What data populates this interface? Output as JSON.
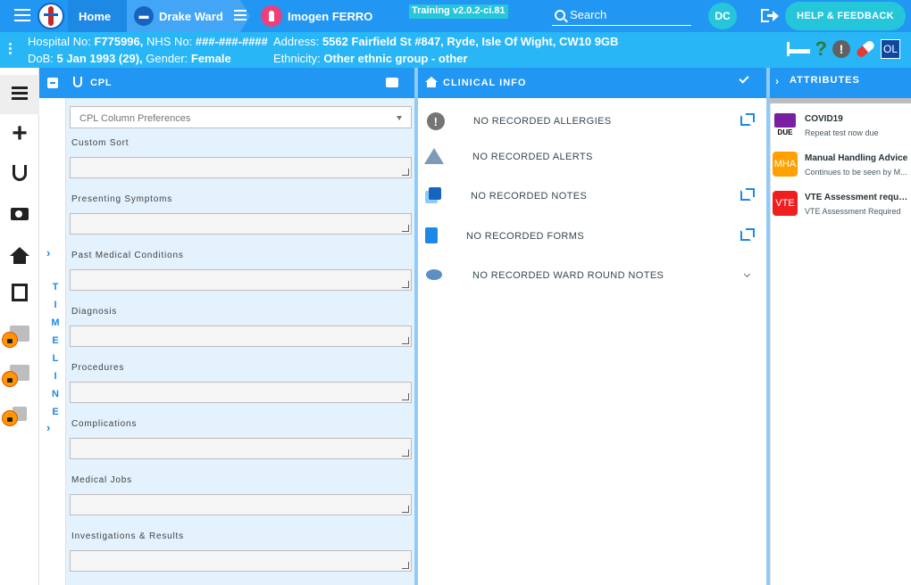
{
  "topbar": {
    "home_label": "Home",
    "ward_label": "Drake Ward",
    "patient_label": "Imogen FERRO",
    "training_badge": "Training v2.0.2-ci.81",
    "search_placeholder": "Search",
    "avatar_initials": "DC",
    "help_label": "HELP & FEEDBACK"
  },
  "patient": {
    "hospital_no_label": "Hospital No:",
    "hospital_no": "F775996,",
    "nhs_no_label": "NHS No:",
    "nhs_no": "###-###-####",
    "address_label": "Address:",
    "address": "5562 Fairfield St #847, Ryde, Isle Of Wight, CW10 9GB",
    "dob_label": "DoB:",
    "dob": "5 Jan 1993 (29),",
    "gender_label": "Gender:",
    "gender": "Female",
    "ethnicity_label": "Ethnicity:",
    "ethnicity": "Other ethnic group - other",
    "ol_badge": "OL"
  },
  "timeline": {
    "label": "TIMELINE"
  },
  "cpl": {
    "title": "CPL",
    "prefs_placeholder": "CPL Column Preferences",
    "fields": [
      {
        "label": "Custom Sort"
      },
      {
        "label": "Presenting Symptoms"
      },
      {
        "label": "Past Medical Conditions"
      },
      {
        "label": "Diagnosis"
      },
      {
        "label": "Procedures"
      },
      {
        "label": "Complications"
      },
      {
        "label": "Medical Jobs"
      },
      {
        "label": "Investigations & Results"
      }
    ]
  },
  "clinical": {
    "title": "CLINICAL INFO",
    "records": [
      {
        "text": "NO RECORDED ALLERGIES"
      },
      {
        "text": "NO RECORDED ALERTS"
      },
      {
        "text": "NO RECORDED NOTES"
      },
      {
        "text": "NO RECORDED FORMS"
      },
      {
        "text": "NO RECORDED WARD ROUND NOTES"
      }
    ]
  },
  "attributes": {
    "title": "ATTRIBUTES",
    "items": [
      {
        "badge": "DUE",
        "title": "COVID19",
        "sub": "Repeat test now due",
        "color": "#7b1fa2"
      },
      {
        "badge": "MHA",
        "title": "Manual Handling Advice",
        "sub": "Continues to be seen by M...",
        "color": "#ffa000"
      },
      {
        "badge": "VTE",
        "title": "VTE Assessment requir...",
        "sub": "VTE Assessment Required",
        "color": "#f01f1f"
      }
    ]
  }
}
